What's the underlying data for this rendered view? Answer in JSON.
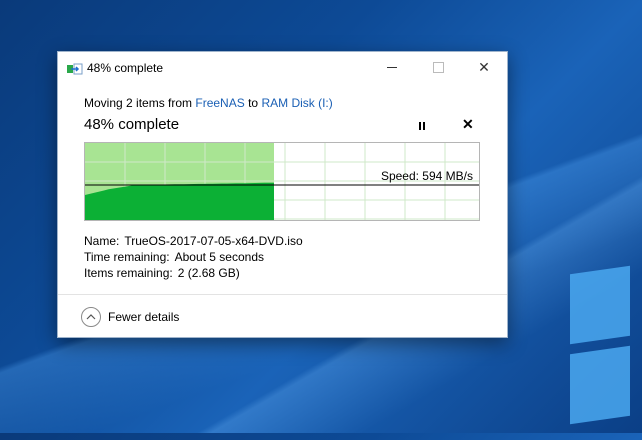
{
  "window": {
    "title": "48% complete"
  },
  "header": {
    "moving_prefix": "Moving 2 items from",
    "source": "FreeNAS",
    "to_word": "to",
    "destination": "RAM Disk (I:)",
    "percent_text": "48% complete"
  },
  "progress": {
    "fraction": 0.48,
    "speed_label": "Speed: 594 MB/s"
  },
  "details": {
    "name_label": "Name:",
    "name_value": "TrueOS-2017-07-05-x64-DVD.iso",
    "time_label": "Time remaining:",
    "time_value": "About 5 seconds",
    "items_label": "Items remaining:",
    "items_value": "2 (2.68 GB)"
  },
  "footer": {
    "fewer_details": "Fewer details"
  },
  "colors": {
    "graph_fill": "#0cb035",
    "graph_done_bg": "#a8e493",
    "link": "#1a5fb4"
  }
}
